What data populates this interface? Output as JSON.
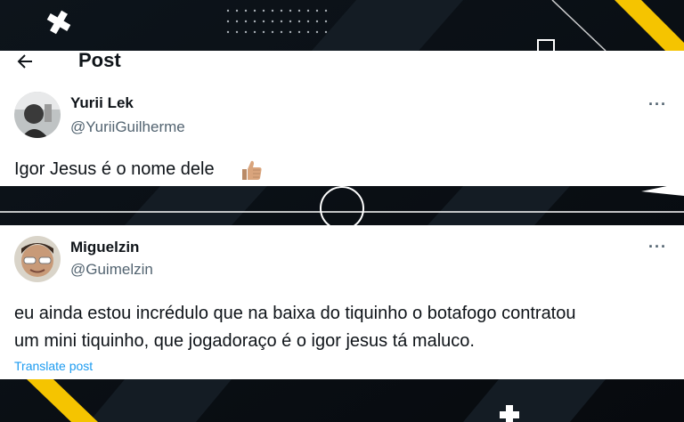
{
  "header": {
    "back_icon": "arrow-left-icon",
    "title": "Post"
  },
  "posts": [
    {
      "display_name": "Yurii Lek",
      "handle": "@YuriiGuilherme",
      "more_label": "···",
      "text": "Igor Jesus é o nome dele",
      "emoji_icon": "thumbs-up-icon"
    },
    {
      "display_name": "Miguelzin",
      "handle": "@Guimelzin",
      "more_label": "···",
      "text_line1": "eu ainda estou incrédulo que na baixa do tiquinho o botafogo contratou",
      "text_line2": "um mini tiquinho, que jogadoraço é o igor jesus tá maluco.",
      "translate_label": "Translate post"
    }
  ],
  "colors": {
    "background": "#0b0f14",
    "accent_yellow": "#f5c400",
    "link_blue": "#1d9bf0",
    "secondary_text": "#536471"
  }
}
